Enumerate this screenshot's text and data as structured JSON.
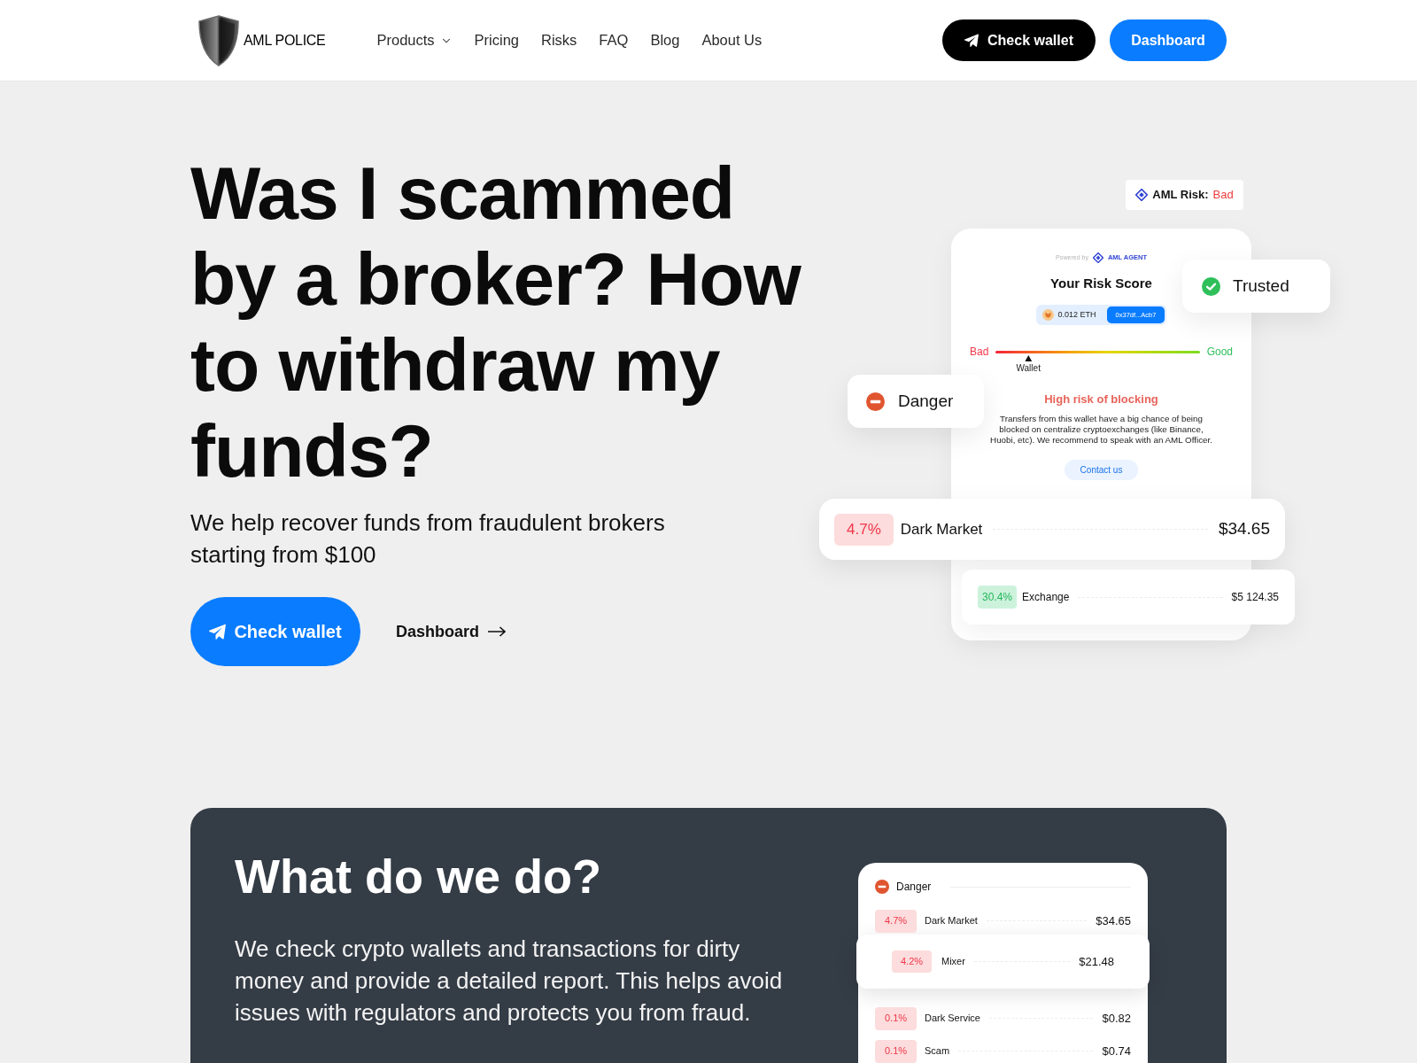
{
  "header": {
    "logo": {
      "text": "AML POLICE"
    },
    "nav": [
      {
        "label": "Products",
        "has_dropdown": true
      },
      {
        "label": "Pricing",
        "has_dropdown": false
      },
      {
        "label": "Risks",
        "has_dropdown": false
      },
      {
        "label": "FAQ",
        "has_dropdown": false
      },
      {
        "label": "Blog",
        "has_dropdown": false
      },
      {
        "label": "About Us",
        "has_dropdown": false
      }
    ],
    "buttons": [
      {
        "kind": "dark",
        "label": "Check wallet"
      },
      {
        "kind": "primary",
        "label": "Dashboard"
      }
    ]
  },
  "hero": {
    "title": "Was I scammed by a broker? How to withdraw my funds?",
    "subtitle": "We help recover funds from fraudulent brokers starting from $100",
    "actions": [
      {
        "kind": "primary",
        "label": "Check wallet"
      },
      {
        "kind": "link",
        "label": "Dashboard"
      }
    ],
    "illustration": {
      "risk_badge": {
        "label": "AML Risk:",
        "value": "Bad"
      },
      "report_card": {
        "powered_by": "Powered by",
        "brand": "AML AGENT",
        "title": "Your Risk Score",
        "amount": "0.012 ETH",
        "address": "0x37df...Acb7",
        "gauge": {
          "low_label": "Bad",
          "high_label": "Good",
          "marker_label": "Wallet",
          "level": 0.16
        },
        "heading": "High risk of blocking",
        "description": "Transfers from this wallet have a big chance of being blocked on centralize cryptoexchanges (like Binance, Huobi, etc). We recommend to speak with an AML Officer.",
        "contact_button": "Contact us"
      },
      "status_cards": [
        {
          "kind": "trusted",
          "label": "Trusted"
        },
        {
          "kind": "danger",
          "label": "Danger"
        }
      ],
      "transactions": [
        {
          "kind": "danger",
          "percent": "4.7%",
          "label": "Dark Market",
          "amount": "$34.65"
        },
        {
          "kind": "safe",
          "percent": "30.4%",
          "label": "Exchange",
          "amount": "$5 124.35"
        }
      ]
    }
  },
  "features": {
    "title": "What do we do?",
    "text": "We check crypto wallets and transactions for dirty money and provide a detailed report. This helps avoid issues with regulators and protects you from fraud.",
    "report": {
      "status": {
        "kind": "danger",
        "label": "Danger"
      },
      "rows": [
        {
          "percent": "4.7%",
          "label": "Dark Market",
          "amount": "$34.65",
          "highlighted": false
        },
        {
          "percent": "4.2%",
          "label": "Mixer",
          "amount": "$21.48",
          "highlighted": true
        },
        {
          "percent": "0.1%",
          "label": "Dark Service",
          "amount": "$0.82",
          "highlighted": false
        },
        {
          "percent": "0.1%",
          "label": "Scam",
          "amount": "$0.74",
          "highlighted": false
        }
      ]
    }
  }
}
